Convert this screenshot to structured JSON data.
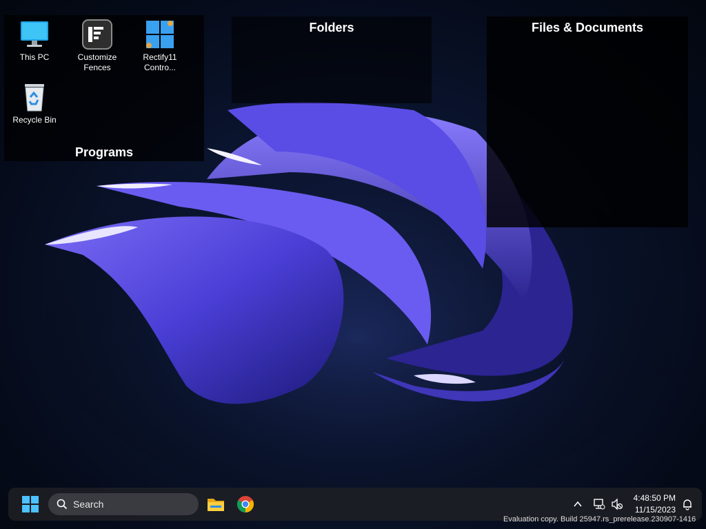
{
  "desktop": {
    "icons": [
      {
        "label": "This PC",
        "icon": "monitor-icon"
      },
      {
        "label": "Customize\nFences",
        "icon": "fences-icon"
      },
      {
        "label": "Rectify11\nContro...",
        "icon": "rectify11-icon"
      },
      {
        "label": "Recycle Bin",
        "icon": "recycle-bin-icon"
      }
    ]
  },
  "fences": {
    "programs": "Programs",
    "folders": "Folders",
    "files": "Files & Documents"
  },
  "taskbar": {
    "search_label": "Search",
    "apps": [
      "file-explorer-icon",
      "chrome-icon"
    ],
    "time": "4:48:50 PM",
    "date": "11/15/2023"
  },
  "watermark": {
    "text": "Evaluation copy. Build 25947.rs_prerelease.230907-1416"
  },
  "colors": {
    "accent": "#0078d4",
    "bloom": "#5b4fe0"
  }
}
